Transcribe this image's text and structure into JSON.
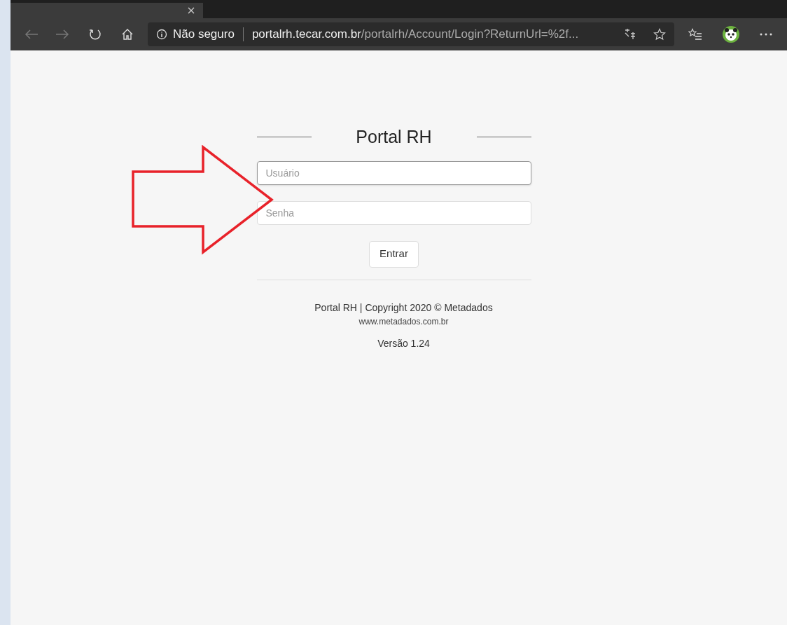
{
  "browser": {
    "security_label": "Não seguro",
    "url_host": "portalrh.tecar.com.br",
    "url_path": "/portalrh/Account/Login?ReturnUrl=%2f..."
  },
  "login": {
    "title": "Portal RH",
    "username": {
      "placeholder": "Usuário"
    },
    "password": {
      "placeholder": "Senha"
    },
    "submit": "Entrar"
  },
  "footer": {
    "copyright": "Portal RH | Copyright 2020 © Metadados",
    "website": "www.metadados.com.br",
    "version": "Versão 1.24"
  }
}
